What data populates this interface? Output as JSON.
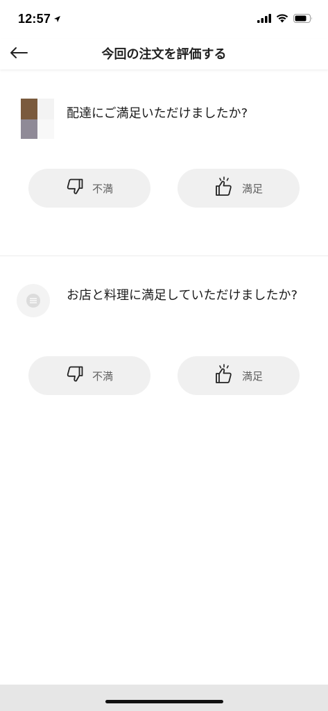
{
  "status_bar": {
    "time": "12:57"
  },
  "header": {
    "title": "今回の注文を評価する"
  },
  "courier_rating": {
    "question": "配達にご満足いただけましたか?",
    "dissatisfied_label": "不満",
    "satisfied_label": "満足"
  },
  "store_rating": {
    "question": "お店と料理に満足していただけましたか?",
    "dissatisfied_label": "不満",
    "satisfied_label": "満足"
  }
}
